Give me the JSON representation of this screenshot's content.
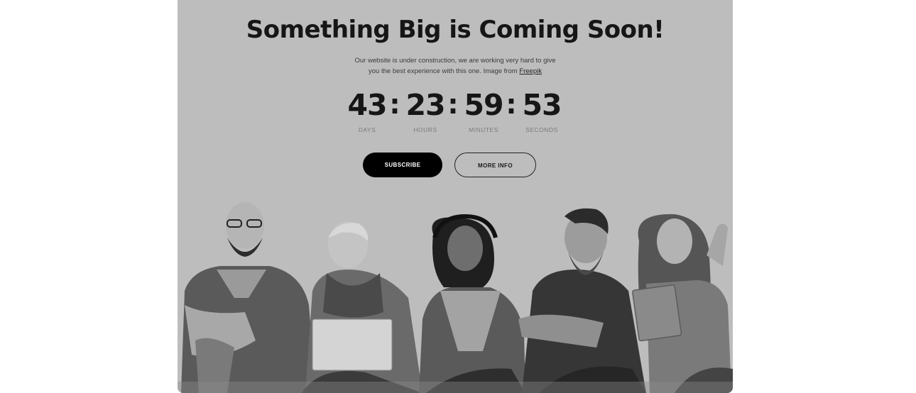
{
  "hero": {
    "title": "Something Big is Coming Soon!",
    "subtitle_line1": "Our website is under construction, we are working very hard to give",
    "subtitle_line2_prefix": "you the best experience with this one. Image from ",
    "subtitle_link": "Freepik"
  },
  "countdown": {
    "days": {
      "value": "43",
      "label": "DAYS"
    },
    "hours": {
      "value": "23",
      "label": "HOURS"
    },
    "minutes": {
      "value": "59",
      "label": "MINUTES"
    },
    "seconds": {
      "value": "53",
      "label": "SECONDS"
    },
    "separator": ":"
  },
  "actions": {
    "subscribe_label": "SUBSCRIBE",
    "more_info_label": "MORE INFO"
  },
  "colors": {
    "card_background": "#bdbdbd",
    "text_dark": "#161616",
    "primary_button": "#000000"
  }
}
